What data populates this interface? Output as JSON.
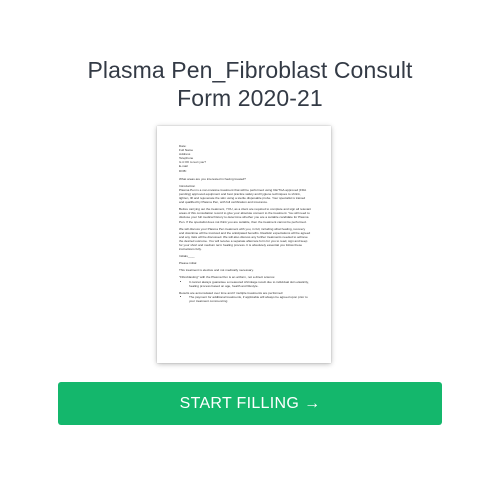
{
  "page": {
    "title_line1": "Plasma Pen_Fibroblast Consult",
    "title_line2": "Form 2020-21"
  },
  "document": {
    "fields": [
      "Date:",
      "Full Name",
      "Address",
      "Telephone",
      "Is it OK to text you?",
      "E-mail",
      "DOB:"
    ],
    "question": "What areas are you interested in having treated?",
    "intro_heading": "Introduction",
    "intro": "Plasma Pen is a non-invasive treatment that will be performed using CE/TGA approved (FDA pending) approved equipment and best practice safety and hygiene techniques to shrink, tighten, lift and rejuvenate the skin using a sterile disposable probe. Your specialist is trained and qualified by Plasma Pen, with full certification and insurance.",
    "para2": "Before carrying out the treatment, YOU, as a client are required to complete and sign all relevant areas of this consultation record to give your absolute consent to the treatment. You will need to disclose your full medical history to determine whether you are a suitable candidate for Plasma Pen. If the specialist does not think you are suitable, then the treatment cannot be performed.",
    "para3": "We will discuss your Plasma Pen treatment with you, in full, including what healing, recovery and downtime will be involved and the anticipated benefits. Realistic expectations will be agreed and any risks will be discussed. We will also discuss any further treatments needed to achieve the desired outcome. You will receive a separate aftercare form for you to read, sign and keep for your short and medium term healing process. It is absolutely essential you follow these instructions fully.",
    "initials": "Initials____",
    "please_initial": "Please initial",
    "elective": "This treatment is elective and not medically necessary.",
    "fibro_heading": "\"Fibroblasting\" with the Plasma Pen is an artform, not a direct science:",
    "fibro_bullet": "It cannot always guarantee a measured shrinkage result due to individual skin elasticity, healing process based on age, health and lifestyle.",
    "results_heading": "Results are accumulated over time and if multiple treatments are performed:",
    "results_bullet": "The payment for additional treatments, if applicable will always be agreed upon prior to your treatment commencing"
  },
  "cta": {
    "label": "START FILLING",
    "arrow": "→",
    "color": "#14b76c"
  }
}
